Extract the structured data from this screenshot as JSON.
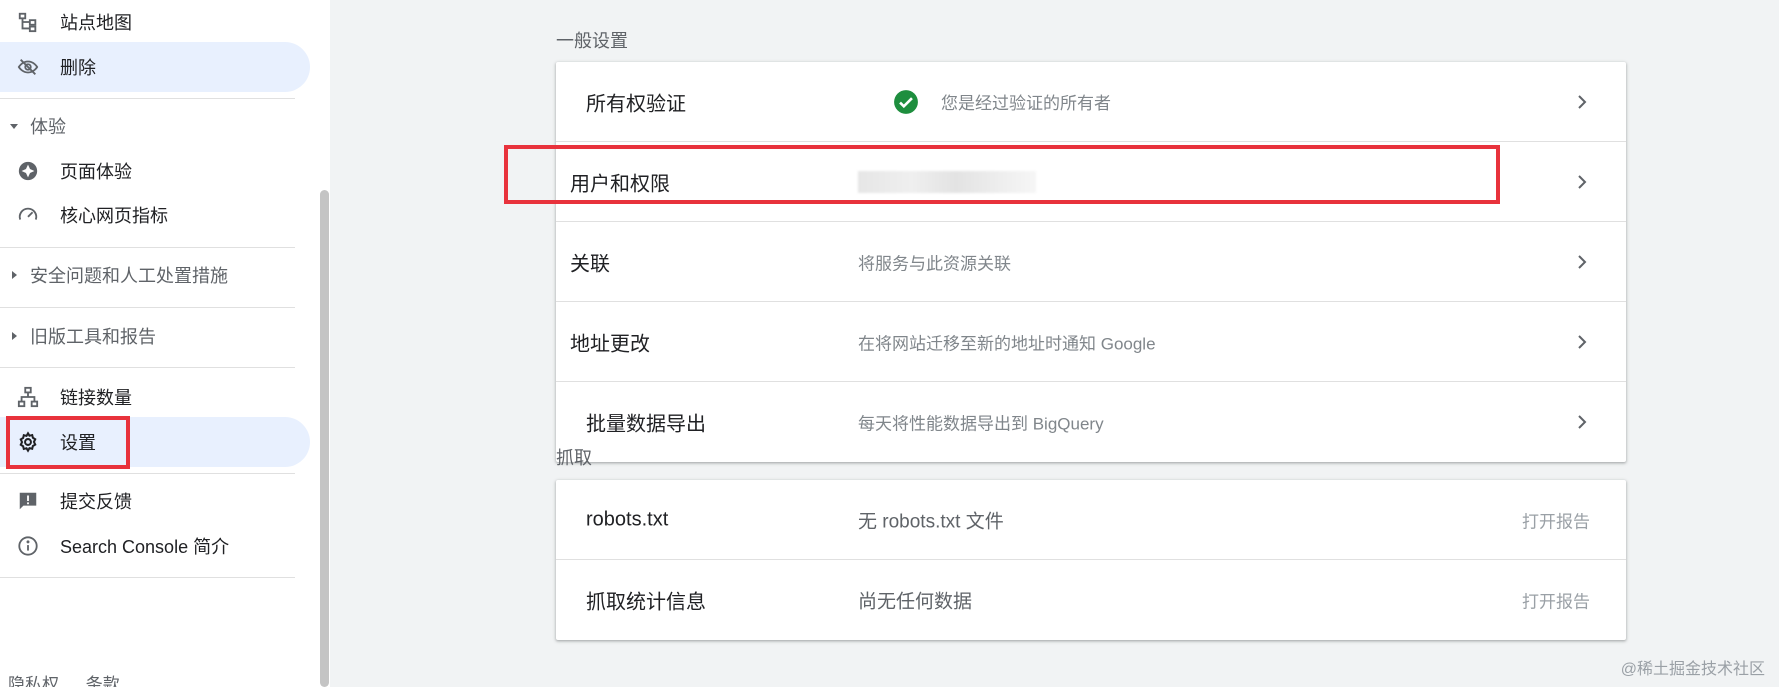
{
  "sidebar": {
    "items": {
      "sitemap": "站点地图",
      "removals": "删除",
      "page_experience": "页面体验",
      "core_web_vitals": "核心网页指标",
      "links": "链接数量",
      "settings": "设置",
      "feedback": "提交反馈",
      "about": "Search Console 简介"
    },
    "sections": {
      "experience": "体验",
      "security": "安全问题和人工处置措施",
      "legacy": "旧版工具和报告"
    },
    "footer": {
      "privacy": "隐私权",
      "terms": "条款"
    },
    "active_item": "settings"
  },
  "main": {
    "general": {
      "title": "一般设置",
      "rows": {
        "ownership": {
          "label": "所有权验证",
          "value": "您是经过验证的所有者"
        },
        "users": {
          "label": "用户和权限"
        },
        "associations": {
          "label": "关联",
          "value": "将服务与此资源关联"
        },
        "change_address": {
          "label": "地址更改",
          "value": "在将网站迁移至新的地址时通知 Google"
        },
        "bulk_export": {
          "label": "批量数据导出",
          "value": "每天将性能数据导出到 BigQuery"
        }
      }
    },
    "crawl": {
      "title": "抓取",
      "rows": {
        "robots": {
          "label": "robots.txt",
          "value": "无 robots.txt 文件",
          "action": "打开报告"
        },
        "crawl_stats": {
          "label": "抓取统计信息",
          "value": "尚无任何数据",
          "action": "打开报告"
        }
      }
    }
  },
  "watermark": "@稀土掘金技术社区",
  "colors": {
    "accent_active_bg": "#e8f0fe",
    "highlight_border": "#e8323c",
    "success_check": "#1e8e3e",
    "icon_grey": "#5f6368"
  }
}
